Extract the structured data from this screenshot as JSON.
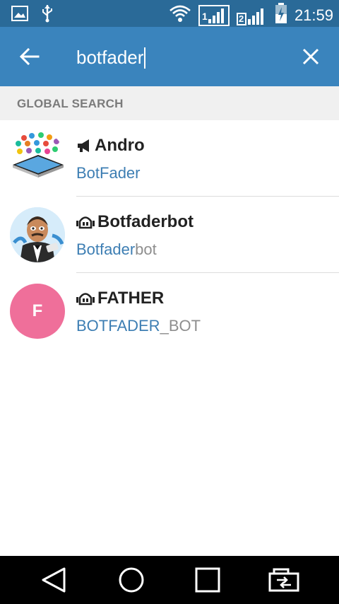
{
  "status_bar": {
    "time": "21:59",
    "sim1_label": "1",
    "sim2_label": "2"
  },
  "app_bar": {
    "search_query": "botfader"
  },
  "section": {
    "title": "GLOBAL SEARCH"
  },
  "results": [
    {
      "type": "channel",
      "name": "Andro",
      "username_match": "BotFader",
      "username_rest": ""
    },
    {
      "type": "bot",
      "name": "Botfaderbot",
      "username_match": "Botfader",
      "username_rest": "bot"
    },
    {
      "type": "bot",
      "name": "FATHER",
      "username_match": "BOTFADER",
      "username_rest": "_BOT",
      "avatar_letter": "F",
      "avatar_color": "#ef6f9a"
    }
  ],
  "colors": {
    "status_bar": "#2a6a98",
    "app_bar": "#3a84bd",
    "highlight": "#3d7eb3"
  }
}
